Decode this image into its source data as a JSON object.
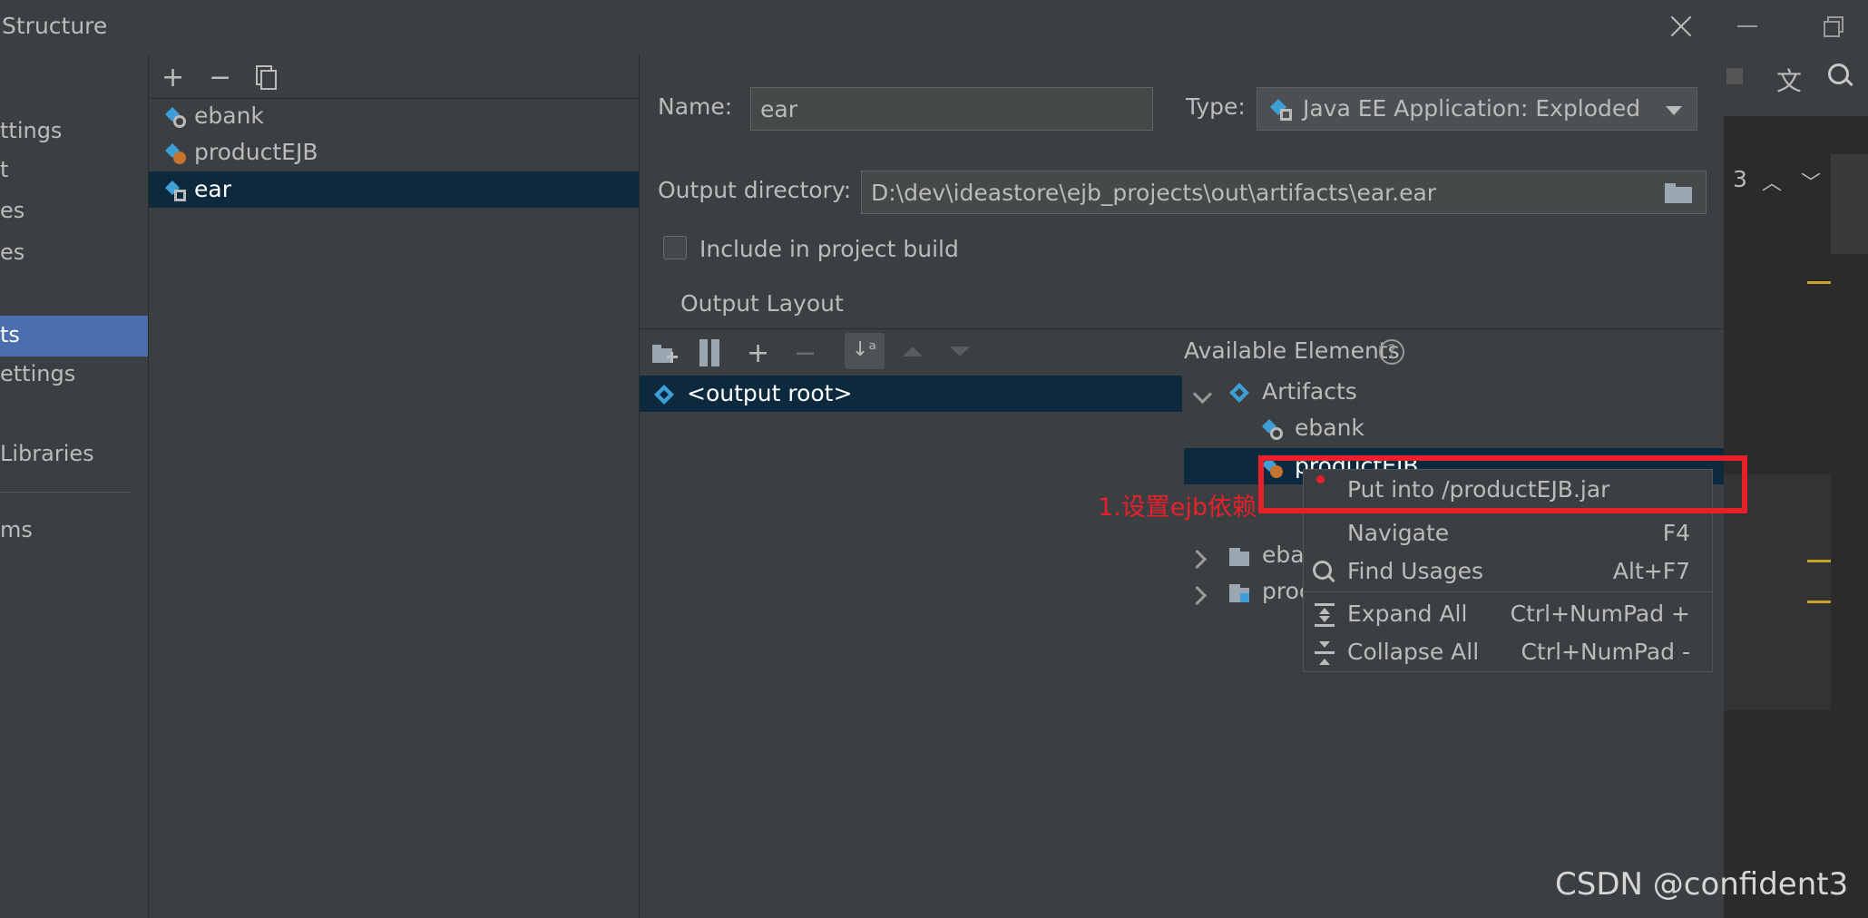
{
  "window": {
    "title": "Structure"
  },
  "left_nav": {
    "items": [
      {
        "label": "ttings"
      },
      {
        "label": "t"
      },
      {
        "label": "es"
      },
      {
        "label": "es"
      },
      {
        "label": "ts"
      },
      {
        "label": "ettings"
      },
      {
        "label": " Libraries"
      },
      {
        "label": "ms"
      }
    ]
  },
  "artifact_list": {
    "toolbar": {
      "add": "+",
      "remove": "−",
      "copy": "copy-icon"
    },
    "items": [
      {
        "label": "ebank"
      },
      {
        "label": "productEJB"
      },
      {
        "label": "ear"
      }
    ],
    "selected": "ear"
  },
  "form": {
    "name_label": "Name:",
    "name_value": "ear",
    "type_label": "Type:",
    "type_value": "Java EE Application: Exploded",
    "output_dir_label": "Output directory:",
    "output_dir_value": "D:\\dev\\ideastore\\ejb_projects\\out\\artifacts\\ear.ear",
    "include_label": "Include in project build",
    "include_checked": false,
    "output_layout_tab": "Output Layout"
  },
  "layout_tree": {
    "root": "<output root>"
  },
  "available": {
    "header": "Available Elements",
    "help": "?",
    "artifacts_label": "Artifacts",
    "artifact_items": [
      {
        "label": "ebank"
      },
      {
        "label": "productEJB"
      }
    ],
    "module_items": [
      {
        "label": "eba"
      },
      {
        "label": "proc"
      }
    ]
  },
  "context_menu": {
    "items": [
      {
        "label": "Put into /productEJB.jar",
        "shortcut": ""
      },
      {
        "label": "Navigate",
        "shortcut": "F4"
      },
      {
        "label": "Find Usages",
        "shortcut": "Alt+F7"
      },
      {
        "label": "Expand All",
        "shortcut": "Ctrl+NumPad +"
      },
      {
        "label": "Collapse All",
        "shortcut": "Ctrl+NumPad -"
      }
    ]
  },
  "annotation": {
    "text": "1.设置ejb依赖",
    "color": "#e8202a"
  },
  "ide_right": {
    "counter": "3"
  },
  "watermark": {
    "text": "CSDN @confident3"
  },
  "colors": {
    "selection": "#0d293e",
    "nav_selected": "#4b6eaf",
    "annotation_red": "#e8202a"
  }
}
